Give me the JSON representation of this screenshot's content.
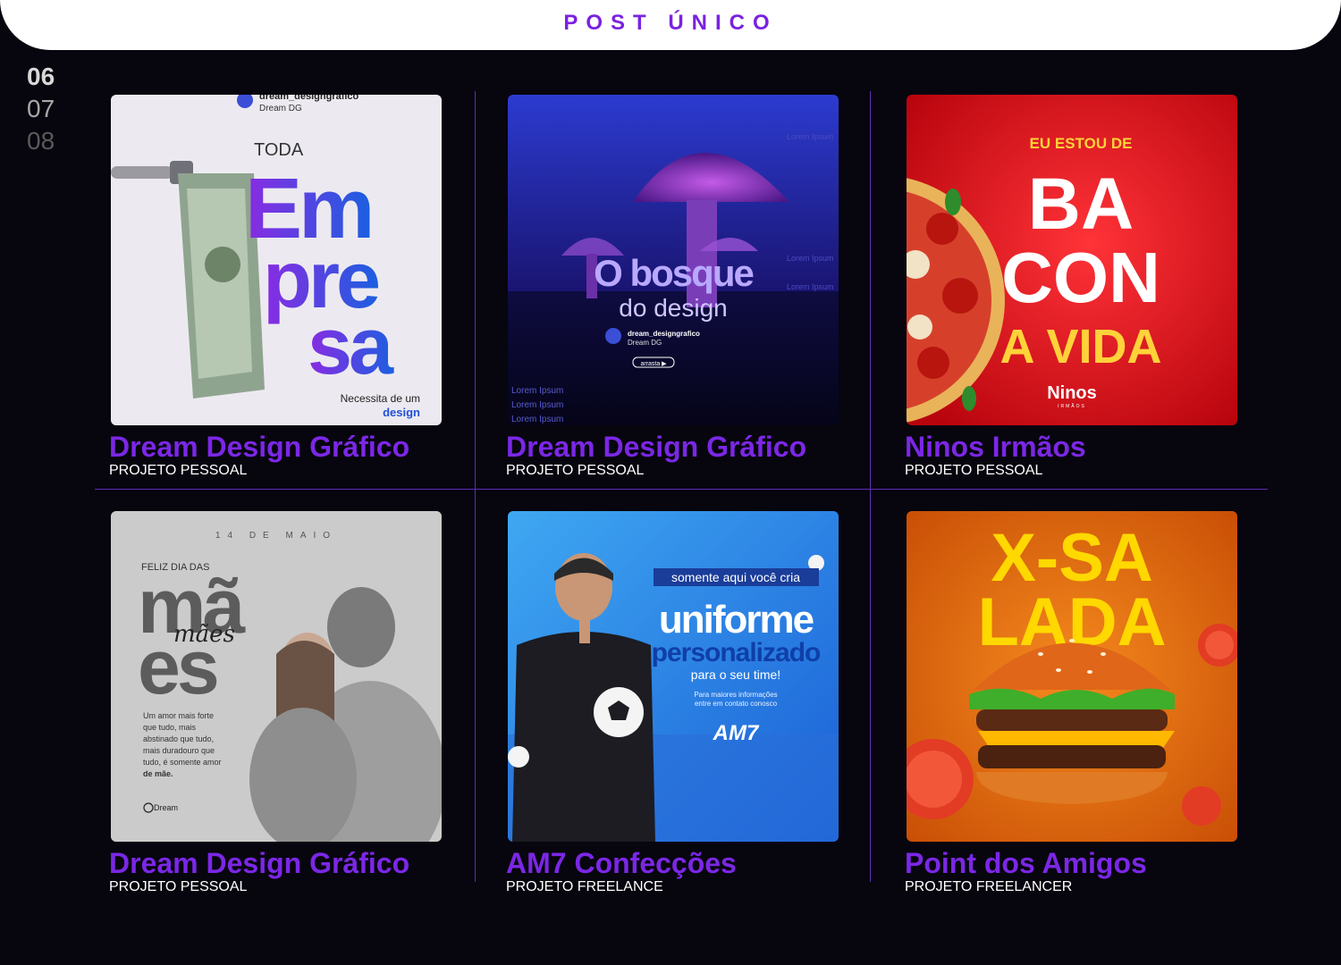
{
  "header": {
    "title": "POST ÚNICO"
  },
  "pager": {
    "pages": [
      "06",
      "07",
      "08"
    ],
    "active": "06"
  },
  "cards": [
    {
      "title": "Dream Design Gráfico",
      "subtitle": "PROJETO PESSOAL",
      "art": {
        "handle": "dream_designgrafico",
        "brand": "Dream DG",
        "pre": "TODA",
        "line1": "Em",
        "line2": "pre",
        "line3": "sa",
        "foot1": "Necessita de um",
        "foot2": "design"
      }
    },
    {
      "title": "Dream Design Gráfico",
      "subtitle": "PROJETO PESSOAL",
      "art": {
        "line1": "O bosque",
        "line2": "do design",
        "handle": "dream_designgrafico",
        "brand": "Dream DG",
        "cta": "arrasta ▶",
        "filler": "Lorem Ipsum"
      }
    },
    {
      "title": "Ninos Irmãos",
      "subtitle": "PROJETO PESSOAL",
      "art": {
        "pre": "EU ESTOU DE",
        "line1": "BA",
        "line2": "CON",
        "line3": "A VIDA",
        "logo": "Ninos",
        "logo_sub": "IRMÃOS"
      }
    },
    {
      "title": "Dream Design Gráfico",
      "subtitle": "PROJETO PESSOAL",
      "art": {
        "date": "14 DE MAIO",
        "pre": "FELIZ DIA DAS",
        "line1": "mã",
        "line2": "es",
        "script": "mães",
        "body": [
          "Um amor mais forte",
          "que tudo, mais",
          "abstinado que tudo,",
          "mais duradouro que",
          "tudo, é somente amor",
          "de mãe."
        ],
        "logo": "Dream"
      }
    },
    {
      "title": "AM7 Confecções",
      "subtitle": "PROJETO FREELANCE",
      "art": {
        "tag": "somente aqui você cria",
        "line1": "uniforme",
        "line2": "personalizado",
        "line3": "para o seu time!",
        "info1": "Para maiores informações",
        "info2": "entre em contato conosco",
        "logo": "AM7"
      }
    },
    {
      "title": "Point dos Amigos",
      "subtitle": "PROJETO FREELANCER",
      "art": {
        "line1": "X-SA",
        "line2": "LADA"
      }
    }
  ],
  "colors": {
    "accent": "#7b27e6",
    "background": "#07050e",
    "divider": "#5f2db5"
  }
}
